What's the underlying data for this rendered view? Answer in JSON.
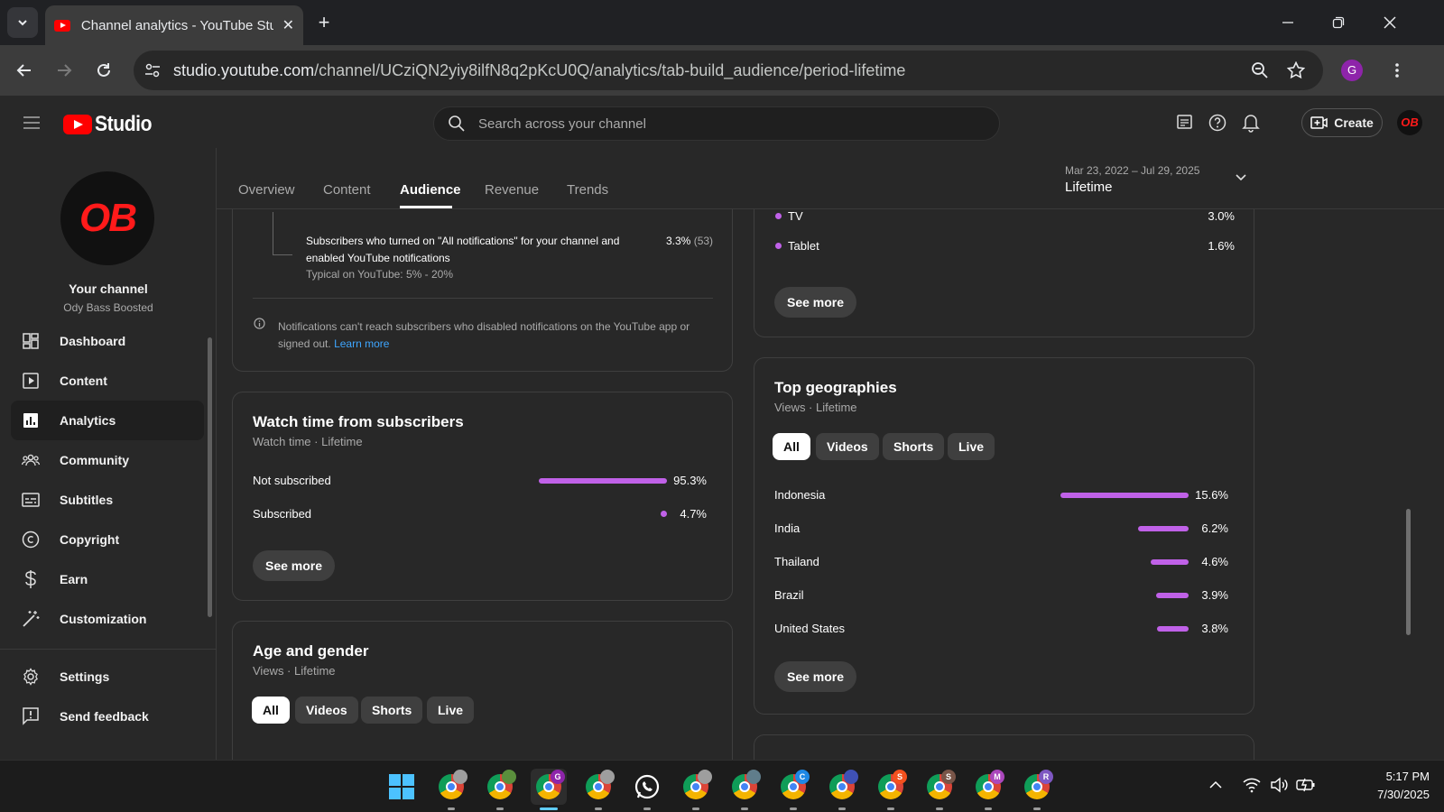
{
  "browser": {
    "tab_title": "Channel analytics - YouTube Studio",
    "url_host": "studio.youtube.com",
    "url_path": "/channel/UCziQN2yiy8ilfN8q2pKcU0Q/analytics/tab-build_audience/period-lifetime",
    "profile_initial": "G"
  },
  "header": {
    "logo_text": "Studio",
    "search_placeholder": "Search across your channel",
    "create_label": "Create",
    "avatar_text": "OB"
  },
  "sidebar": {
    "avatar_text": "OB",
    "channel_title": "Your channel",
    "channel_name": "Ody Bass Boosted",
    "items": [
      {
        "label": "Dashboard",
        "icon": "dashboard-icon"
      },
      {
        "label": "Content",
        "icon": "content-icon"
      },
      {
        "label": "Analytics",
        "icon": "analytics-icon",
        "active": true
      },
      {
        "label": "Community",
        "icon": "community-icon"
      },
      {
        "label": "Subtitles",
        "icon": "subtitles-icon"
      },
      {
        "label": "Copyright",
        "icon": "copyright-icon"
      },
      {
        "label": "Earn",
        "icon": "earn-icon"
      },
      {
        "label": "Customization",
        "icon": "customization-icon"
      }
    ],
    "bottom_items": [
      {
        "label": "Settings",
        "icon": "gear-icon"
      },
      {
        "label": "Send feedback",
        "icon": "feedback-icon"
      }
    ]
  },
  "analytics_tabs": [
    "Overview",
    "Content",
    "Audience",
    "Revenue",
    "Trends"
  ],
  "active_tab": "Audience",
  "period": {
    "range": "Mar 23, 2022 – Jul 29, 2025",
    "label": "Lifetime"
  },
  "notifications_card": {
    "line1": "Subscribers who turned on \"All notifications\" for your channel and",
    "line2": "enabled YouTube notifications",
    "typical": "Typical on YouTube: 5% - 20%",
    "pct": "3.3%",
    "count": "(53)",
    "info_line1": "Notifications can't reach subscribers who disabled notifications on the YouTube app or",
    "info_line2": "signed out.",
    "learn_more": "Learn more"
  },
  "watch_time_card": {
    "title": "Watch time from subscribers",
    "subtitle": "Watch time · Lifetime",
    "rows": [
      {
        "label": "Not subscribed",
        "value": "95.3%",
        "fraction": 0.953
      },
      {
        "label": "Subscribed",
        "value": "4.7%",
        "fraction": 0.047
      }
    ],
    "see_more": "See more"
  },
  "age_gender_card": {
    "title": "Age and gender",
    "subtitle": "Views · Lifetime",
    "chips": [
      "All",
      "Videos",
      "Shorts",
      "Live"
    ]
  },
  "device_card": {
    "rows": [
      {
        "label": "TV",
        "value": "3.0%"
      },
      {
        "label": "Tablet",
        "value": "1.6%"
      }
    ],
    "see_more": "See more"
  },
  "geographies_card": {
    "title": "Top geographies",
    "subtitle": "Views · Lifetime",
    "chips": [
      "All",
      "Videos",
      "Shorts",
      "Live"
    ],
    "rows": [
      {
        "label": "Indonesia",
        "value": "15.6%",
        "fraction": 0.156
      },
      {
        "label": "India",
        "value": "6.2%",
        "fraction": 0.062
      },
      {
        "label": "Thailand",
        "value": "4.6%",
        "fraction": 0.046
      },
      {
        "label": "Brazil",
        "value": "3.9%",
        "fraction": 0.039
      },
      {
        "label": "United States",
        "value": "3.8%",
        "fraction": 0.038
      }
    ],
    "see_more": "See more"
  },
  "taskbar": {
    "apps": [
      {
        "name": "start-menu-icon"
      },
      {
        "name": "chrome-profile-1-icon",
        "badge": "",
        "badge_color": "#9e9e9e"
      },
      {
        "name": "chrome-profile-2-icon",
        "badge": "",
        "badge_color": "#5a8f3c"
      },
      {
        "name": "chrome-profile-g-icon",
        "badge": "G",
        "badge_color": "#8e24aa",
        "active": true
      },
      {
        "name": "chrome-profile-3-icon",
        "badge": "",
        "badge_color": "#9e9e9e"
      },
      {
        "name": "whatsapp-icon"
      },
      {
        "name": "chrome-profile-4-icon",
        "badge": "",
        "badge_color": "#9e9e9e"
      },
      {
        "name": "chrome-profile-5-icon",
        "badge": "",
        "badge_color": "#607d8b"
      },
      {
        "name": "chrome-profile-c-icon",
        "badge": "C",
        "badge_color": "#1e88e5"
      },
      {
        "name": "chrome-profile-6-icon",
        "badge": "",
        "badge_color": "#3f51b5"
      },
      {
        "name": "chrome-profile-s-icon",
        "badge": "S",
        "badge_color": "#f4511e"
      },
      {
        "name": "chrome-profile-s2-icon",
        "badge": "S",
        "badge_color": "#795548"
      },
      {
        "name": "chrome-profile-m-icon",
        "badge": "M",
        "badge_color": "#ab47bc"
      },
      {
        "name": "chrome-profile-r-icon",
        "badge": "R",
        "badge_color": "#7e57c2"
      }
    ],
    "time": "5:17 PM",
    "date": "7/30/2025"
  }
}
